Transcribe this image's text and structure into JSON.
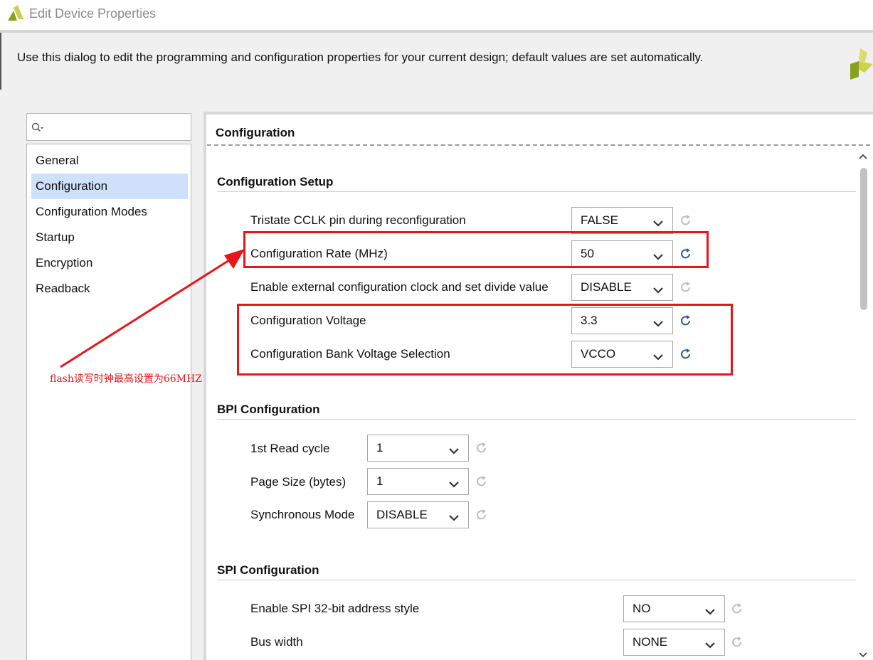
{
  "window": {
    "title": "Edit Device Properties"
  },
  "description": "Use this dialog to edit the programming and configuration properties for your current design; default values are set automatically.",
  "search": {
    "placeholder": ""
  },
  "sidebar": {
    "items": [
      {
        "label": "General",
        "selected": false
      },
      {
        "label": "Configuration",
        "selected": true
      },
      {
        "label": "Configuration Modes",
        "selected": false
      },
      {
        "label": "Startup",
        "selected": false
      },
      {
        "label": "Encryption",
        "selected": false
      },
      {
        "label": "Readback",
        "selected": false
      }
    ]
  },
  "panel": {
    "title": "Configuration",
    "sections": [
      {
        "title": "Configuration Setup",
        "rows": [
          {
            "label": "Tristate CCLK pin during reconfiguration",
            "value": "FALSE",
            "reset_active": false
          },
          {
            "label": "Configuration Rate (MHz)",
            "value": "50",
            "reset_active": true
          },
          {
            "label": "Enable external configuration clock and set divide value",
            "value": "DISABLE",
            "reset_active": false
          },
          {
            "label": "Configuration Voltage",
            "value": "3.3",
            "reset_active": true
          },
          {
            "label": "Configuration Bank Voltage Selection",
            "value": "VCCO",
            "reset_active": true
          }
        ]
      },
      {
        "title": "BPI Configuration",
        "rows": [
          {
            "label": "1st Read cycle",
            "value": "1",
            "reset_active": false
          },
          {
            "label": "Page Size (bytes)",
            "value": "1",
            "reset_active": false
          },
          {
            "label": "Synchronous Mode",
            "value": "DISABLE",
            "reset_active": false
          }
        ]
      },
      {
        "title": "SPI Configuration",
        "rows": [
          {
            "label": "Enable SPI 32-bit address style",
            "value": "NO",
            "reset_active": false
          },
          {
            "label": "Bus width",
            "value": "NONE",
            "reset_active": false
          }
        ]
      }
    ]
  },
  "annotation": {
    "text": "flash读写时钟最高设置为66MHZ",
    "color": "#e8151b"
  },
  "colors": {
    "selection": "#cfe0fb",
    "reset_active": "#2c5a8c",
    "reset_inactive": "#bdbdbd",
    "brand_green": "#8aa023"
  },
  "icons": {
    "app_logo": "vivado-logo-icon",
    "search": "search-icon",
    "dropdown": "chevron-down-icon",
    "reset": "refresh-icon"
  }
}
